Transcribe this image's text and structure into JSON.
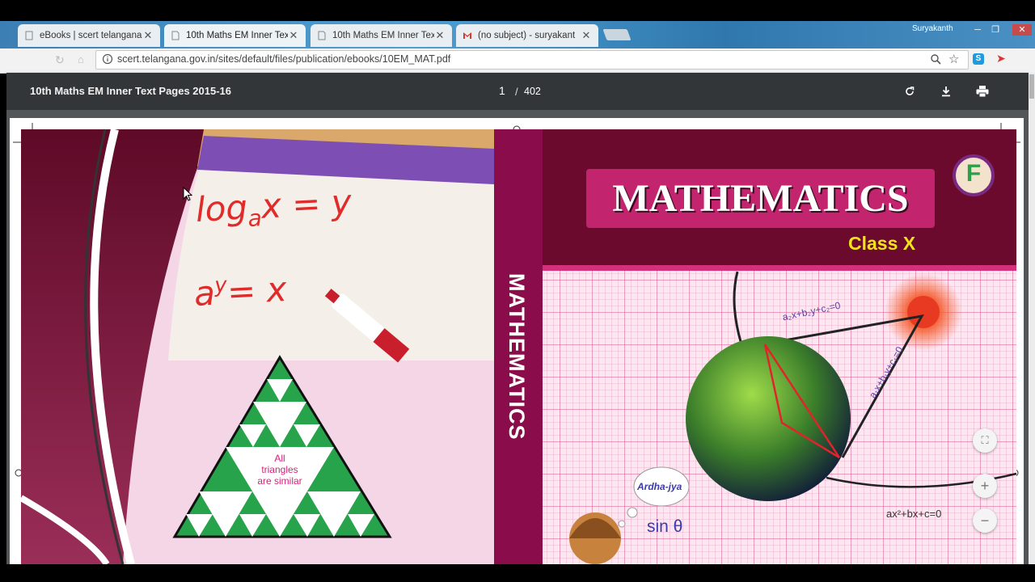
{
  "browser": {
    "tabs": [
      {
        "title": "eBooks | scert telangana",
        "icon": "page-icon"
      },
      {
        "title": "10th Maths EM Inner Tex",
        "icon": "document-icon"
      },
      {
        "title": "10th Maths EM Inner Tex",
        "icon": "document-icon"
      },
      {
        "title": "(no subject) - suryakant",
        "icon": "gmail-icon"
      }
    ],
    "active_tab": 1,
    "close_glyph": "✕",
    "profile_name": "Suryakanth",
    "window_controls": [
      "minimize",
      "restore",
      "close"
    ],
    "url": "scert.telangana.gov.in/sites/default/files/publication/ebooks/10EM_MAT.pdf",
    "colors": {
      "accent": "#3b7fb4",
      "frame": "#000000"
    }
  },
  "pdf": {
    "title": "10th Maths EM Inner Text Pages 2015-16",
    "current_page": "1",
    "separator": "/",
    "total_pages": "402",
    "toolbar_icons": [
      "rotate-icon",
      "download-icon",
      "print-icon"
    ],
    "zoom_controls": {
      "fit": "⛶",
      "zoom_in": "+",
      "zoom_out": "−"
    },
    "colors": {
      "toolbar": "#323639",
      "viewer_bg": "#525659"
    }
  },
  "cover": {
    "title": "MATHEMATICS",
    "class_label": "Class X",
    "badge": "F",
    "spine_title": "MATHEMATICS",
    "whiteboard_line1": "log",
    "whiteboard_line1_sub": "a",
    "whiteboard_line1_rest": "x = y",
    "whiteboard_line2": "a",
    "whiteboard_line2_sup": "y",
    "whiteboard_line2_rest": "= x",
    "triangle_text": [
      "All",
      "triangles",
      "are similar"
    ],
    "line_eq1": "a₁x+b₁y+c₁=0",
    "line_eq2": "a₂x+b₂y+c₂=0",
    "quadratic": "ax²+bx+c=0",
    "thought_bubble": "Ardha-jya",
    "trig": "sin θ",
    "colors": {
      "maroon": "#6b0a2c",
      "magenta": "#c2246e",
      "spine": "#8a0c4a",
      "yellow": "#f2e21a"
    }
  }
}
